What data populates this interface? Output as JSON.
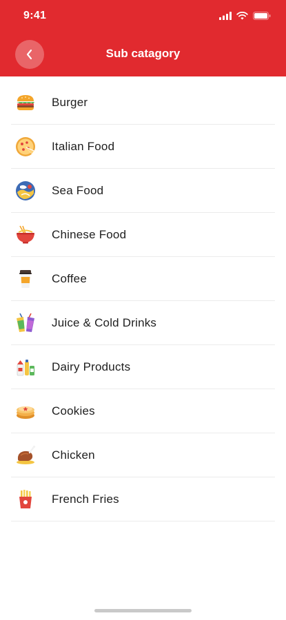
{
  "status_bar": {
    "time": "9:41"
  },
  "header": {
    "title": "Sub catagory",
    "back_icon": "chevron-left-icon"
  },
  "categories": [
    {
      "label": "Burger",
      "icon": "burger-icon"
    },
    {
      "label": "Italian Food",
      "icon": "pizza-icon"
    },
    {
      "label": "Sea Food",
      "icon": "seafood-icon"
    },
    {
      "label": "Chinese Food",
      "icon": "noodle-bowl-icon"
    },
    {
      "label": "Coffee",
      "icon": "coffee-cup-icon"
    },
    {
      "label": "Juice & Cold Drinks",
      "icon": "juice-icon"
    },
    {
      "label": "Dairy Products",
      "icon": "dairy-icon"
    },
    {
      "label": "Cookies",
      "icon": "cookie-icon"
    },
    {
      "label": "Chicken",
      "icon": "chicken-icon"
    },
    {
      "label": "French Fries",
      "icon": "fries-icon"
    }
  ],
  "colors": {
    "header": "#e12a2f",
    "text": "#1e1e1e",
    "divider": "#ebebeb"
  }
}
